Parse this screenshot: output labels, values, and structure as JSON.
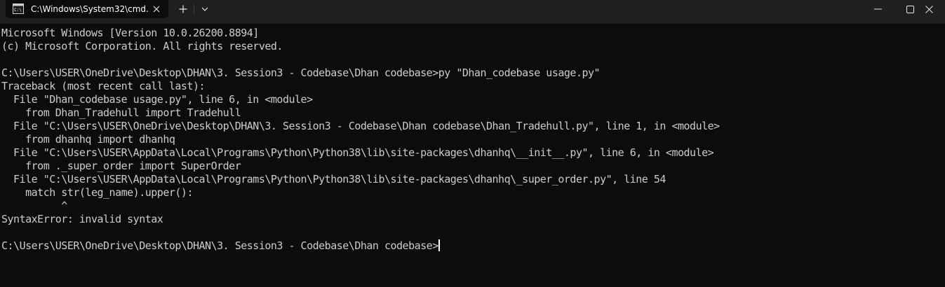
{
  "tab": {
    "title": "C:\\Windows\\System32\\cmd.e",
    "icon": "console-icon",
    "close_icon": "close-icon",
    "new_tab_icon": "plus-icon",
    "dropdown_icon": "chevron-down-icon"
  },
  "window_controls": {
    "minimize_icon": "minimize-icon",
    "maximize_icon": "maximize-icon",
    "close_icon": "close-icon"
  },
  "colors": {
    "background": "#0c0c0c",
    "titlebar": "#1f1f1f",
    "text": "#cccccc"
  },
  "console": {
    "lines": [
      "Microsoft Windows [Version 10.0.26200.8894]",
      "(c) Microsoft Corporation. All rights reserved.",
      "",
      "C:\\Users\\USER\\OneDrive\\Desktop\\DHAN\\3. Session3 - Codebase\\Dhan codebase>py \"Dhan_codebase usage.py\"",
      "Traceback (most recent call last):",
      "  File \"Dhan_codebase usage.py\", line 6, in <module>",
      "    from Dhan_Tradehull import Tradehull",
      "  File \"C:\\Users\\USER\\OneDrive\\Desktop\\DHAN\\3. Session3 - Codebase\\Dhan codebase\\Dhan_Tradehull.py\", line 1, in <module>",
      "    from dhanhq import dhanhq",
      "  File \"C:\\Users\\USER\\AppData\\Local\\Programs\\Python\\Python38\\lib\\site-packages\\dhanhq\\__init__.py\", line 6, in <module>",
      "    from ._super_order import SuperOrder",
      "  File \"C:\\Users\\USER\\AppData\\Local\\Programs\\Python\\Python38\\lib\\site-packages\\dhanhq\\_super_order.py\", line 54",
      "    match str(leg_name).upper():",
      "          ^",
      "SyntaxError: invalid syntax",
      ""
    ],
    "prompt": "C:\\Users\\USER\\OneDrive\\Desktop\\DHAN\\3. Session3 - Codebase\\Dhan codebase>"
  }
}
